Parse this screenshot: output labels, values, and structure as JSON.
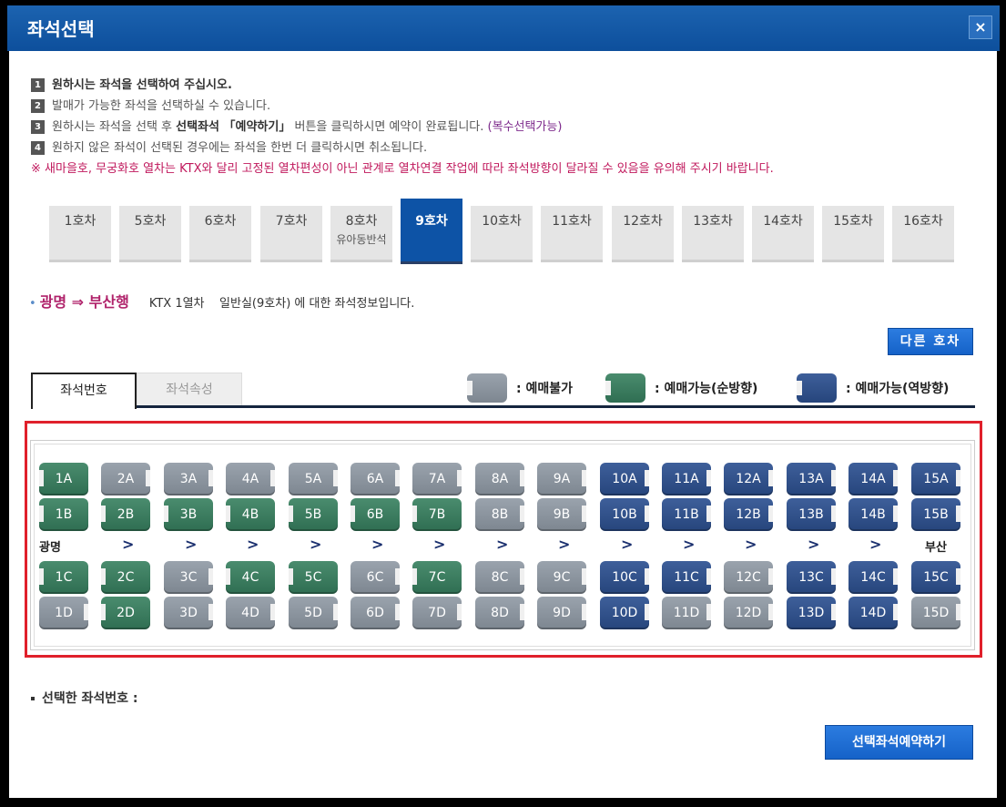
{
  "window": {
    "title": "좌석선택",
    "close_label": "×"
  },
  "instructions": [
    {
      "num": "1",
      "text": "원하시는 좌석을 선택하여 주십시오."
    },
    {
      "num": "2",
      "text": "발매가 가능한 좌석을 선택하실 수 있습니다."
    },
    {
      "num": "3",
      "pre": "원하시는 좌석을 선택 후 ",
      "bold": "선택좌석 「예약하기」",
      "post": " 버튼을 클릭하시면 예약이 완료됩니다. ",
      "note": "(복수선택가능)"
    },
    {
      "num": "4",
      "text": "원하지 않은 좌석이 선택된 경우에는 좌석을 한번 더 클릭하시면 취소됩니다."
    }
  ],
  "warning": "※ 새마을호, 무궁화호 열차는 KTX와 달리 고정된 열차편성이 아닌 관계로 열차연결 작업에 따라 좌석방향이 달라질 수 있음을 유의해 주시기 바랍니다.",
  "cars": [
    {
      "label": "1호차",
      "sub": ""
    },
    {
      "label": "5호차",
      "sub": ""
    },
    {
      "label": "6호차",
      "sub": ""
    },
    {
      "label": "7호차",
      "sub": ""
    },
    {
      "label": "8호차",
      "sub": "유아동반석"
    },
    {
      "label": "9호차",
      "sub": "",
      "active": true
    },
    {
      "label": "10호차",
      "sub": ""
    },
    {
      "label": "11호차",
      "sub": ""
    },
    {
      "label": "12호차",
      "sub": ""
    },
    {
      "label": "13호차",
      "sub": ""
    },
    {
      "label": "14호차",
      "sub": ""
    },
    {
      "label": "15호차",
      "sub": ""
    },
    {
      "label": "16호차",
      "sub": ""
    }
  ],
  "route": {
    "bullet": "•",
    "title": "광명 ⇒ 부산행",
    "train": "KTX 1열차",
    "class": "일반실(9호차)",
    "suffix": "에 대한 좌석정보입니다."
  },
  "buttons": {
    "other_car": "다른 호차",
    "reserve": "선택좌석예약하기"
  },
  "tabs": {
    "seat_number": "좌석번호",
    "seat_attr": "좌석속성"
  },
  "legend": [
    {
      "label": ": 예매불가",
      "color": "#8a939d"
    },
    {
      "label": ": 예매가능(순방향)",
      "color": "#3b7d60"
    },
    {
      "label": ": 예매가능(역방향)",
      "color": "#30528c"
    }
  ],
  "stations": {
    "from": "광명",
    "to": "부산",
    "arrow": ">"
  },
  "seat_status_colors": {
    "unavail": "#8a939d",
    "fwd": "#3b7d60",
    "rev": "#30528c"
  },
  "seats": {
    "A": [
      "fwd",
      "unavail",
      "unavail",
      "unavail",
      "unavail",
      "unavail",
      "unavail",
      "unavail",
      "unavail",
      "rev",
      "rev",
      "rev",
      "rev",
      "rev",
      "rev"
    ],
    "B": [
      "fwd",
      "fwd",
      "fwd",
      "fwd",
      "fwd",
      "fwd",
      "fwd",
      "unavail",
      "unavail",
      "rev",
      "rev",
      "rev",
      "rev",
      "rev",
      "rev"
    ],
    "C": [
      "fwd",
      "fwd",
      "unavail",
      "fwd",
      "fwd",
      "unavail",
      "fwd",
      "unavail",
      "unavail",
      "rev",
      "rev",
      "unavail",
      "rev",
      "rev",
      "rev"
    ],
    "D": [
      "unavail",
      "fwd",
      "unavail",
      "unavail",
      "unavail",
      "unavail",
      "unavail",
      "unavail",
      "unavail",
      "rev",
      "unavail",
      "unavail",
      "rev",
      "rev",
      "unavail"
    ]
  },
  "selected_label": "선택한 좌석번호 :"
}
